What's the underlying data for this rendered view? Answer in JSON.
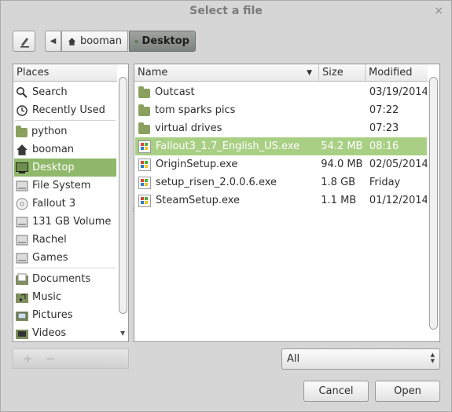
{
  "title": "Select a file",
  "close_glyph": "×",
  "path_bar": {
    "crumbs": [
      {
        "label": "booman",
        "icon": "home-icon"
      },
      {
        "label": "Desktop",
        "icon": "desktop-icon"
      }
    ]
  },
  "places": {
    "header": "Places",
    "items": [
      {
        "label": "Search",
        "icon": "search-icon"
      },
      {
        "label": "Recently Used",
        "icon": "recent-icon"
      },
      {
        "label": "python",
        "icon": "folder-icon"
      },
      {
        "label": "booman",
        "icon": "home-icon"
      },
      {
        "label": "Desktop",
        "icon": "desktop-icon",
        "selected": true
      },
      {
        "label": "File System",
        "icon": "drive-icon"
      },
      {
        "label": "Fallout 3",
        "icon": "optical-disc-icon"
      },
      {
        "label": "131 GB Volume",
        "icon": "drive-icon"
      },
      {
        "label": "Rachel",
        "icon": "drive-icon"
      },
      {
        "label": "Games",
        "icon": "drive-icon"
      },
      {
        "label": "Documents",
        "icon": "documents-icon"
      },
      {
        "label": "Music",
        "icon": "music-icon"
      },
      {
        "label": "Pictures",
        "icon": "pictures-icon"
      },
      {
        "label": "Videos",
        "icon": "videos-icon"
      }
    ],
    "add_glyph": "+",
    "remove_glyph": "−"
  },
  "files": {
    "columns": {
      "name": "Name",
      "size": "Size",
      "modified": "Modified"
    },
    "sort_glyph": "▼",
    "rows": [
      {
        "name": "Outcast",
        "size": "",
        "modified": "03/19/2014",
        "type": "folder"
      },
      {
        "name": "tom sparks pics",
        "size": "",
        "modified": "07:22",
        "type": "folder"
      },
      {
        "name": "virtual drives",
        "size": "",
        "modified": "07:23",
        "type": "folder"
      },
      {
        "name": "Fallout3_1.7_English_US.exe",
        "size": "54.2 MB",
        "modified": "08:16",
        "type": "exe",
        "selected": true
      },
      {
        "name": "OriginSetup.exe",
        "size": "94.0 MB",
        "modified": "02/05/2014",
        "type": "exe"
      },
      {
        "name": "setup_risen_2.0.0.6.exe",
        "size": "1.8 GB",
        "modified": "Friday",
        "type": "exe"
      },
      {
        "name": "SteamSetup.exe",
        "size": "1.1 MB",
        "modified": "01/12/2014",
        "type": "exe"
      }
    ]
  },
  "filter": {
    "value": "All"
  },
  "buttons": {
    "cancel": "Cancel",
    "open": "Open"
  },
  "colors": {
    "selection": "#8fb86a",
    "file_selection": "#a9cf84",
    "folder": "#8aa05f"
  }
}
